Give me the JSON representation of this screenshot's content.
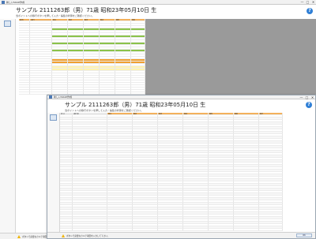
{
  "back_window": {
    "titlebar": {
      "title": "新しいSOAP作成",
      "minimize": "—",
      "maximize": "□",
      "close": "✕"
    },
    "patient_title": "サンプル 2111263郎（男）71歳 昭和23年05月10日 生",
    "subtitle": "当ポイントへの移行ボタンを押して入力・編集の状態をご確認ください。",
    "help": "?",
    "side_label": "入力",
    "status_text": "ボタンで必要なカルテ項目を入力して下さい。",
    "grid_columns": [
      "検査",
      "項目",
      "値1",
      "値2",
      "値3",
      "値4",
      "値5",
      "値6"
    ],
    "colors": {
      "header": "#f3b15c",
      "green": "#8bc34a",
      "orange": "#f0a030",
      "yellow": "#fff3b0",
      "gray_area": "#9a9a9a"
    }
  },
  "front_window": {
    "titlebar": {
      "title": "新しいSOAP作成",
      "minimize": "—",
      "maximize": "□",
      "close": "✕"
    },
    "patient_title": "サンプル 2111263郎（男）71歳 昭和23年05月10日 生",
    "subtitle": "当ポイントへの移行ボタンを押して入力・編集の状態をご確認ください。",
    "help": "?",
    "side_label": "入力",
    "status_text": "ボタンで必要なカルテ項目を入力して下さい。",
    "ok_button": "OK",
    "grid_columns": [
      "区分",
      "項目名",
      "値1",
      "値2",
      "値3",
      "値4",
      "値5",
      "値6",
      "値7"
    ],
    "colors": {
      "header": "#f3b15c",
      "row_alt": "#f7f7f7"
    }
  }
}
